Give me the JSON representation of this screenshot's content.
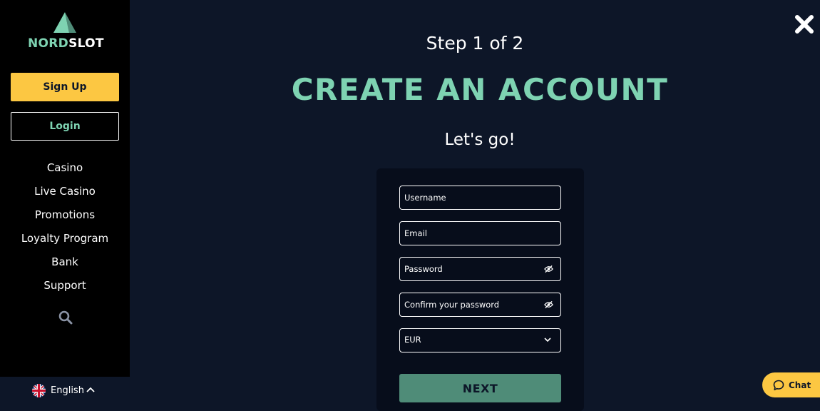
{
  "brand": {
    "logo_part1": "NORD",
    "logo_part2": "SLOT"
  },
  "sidebar": {
    "signup_label": "Sign Up",
    "login_label": "Login",
    "items": [
      {
        "label": "Casino"
      },
      {
        "label": "Live Casino"
      },
      {
        "label": "Promotions"
      },
      {
        "label": "Loyalty Program"
      },
      {
        "label": "Bank"
      },
      {
        "label": "Support"
      }
    ],
    "language": "English"
  },
  "main": {
    "step": "Step 1 of 2",
    "title": "CREATE AN ACCOUNT",
    "subtitle": "Let's go!",
    "form": {
      "username_placeholder": "Username",
      "email_placeholder": "Email",
      "password_placeholder": "Password",
      "confirm_placeholder": "Confirm your password",
      "currency": "EUR",
      "next_label": "NEXT"
    }
  },
  "chat": {
    "label": "Chat"
  },
  "icons": {
    "close": "close-icon",
    "search": "search-icon",
    "eye": "eye-off-icon",
    "flag": "uk-flag-icon",
    "chat": "chat-bubble-icon"
  },
  "colors": {
    "background": "#0d1628",
    "sidebar": "#000000",
    "accent_mint": "#7ed3b2",
    "accent_yellow": "#fcc742",
    "button_next": "#4f8c78"
  }
}
